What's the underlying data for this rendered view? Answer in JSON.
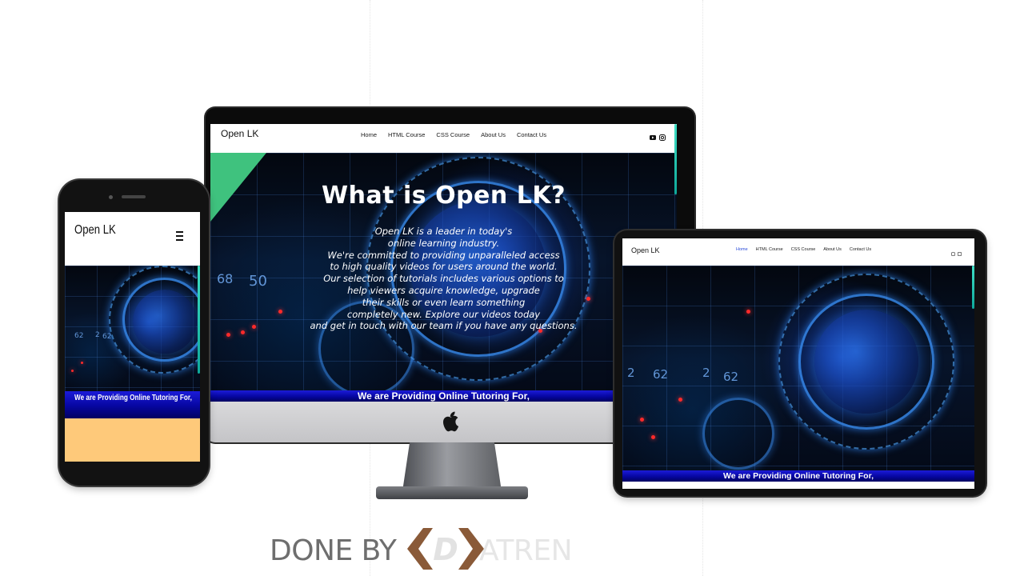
{
  "brand": "Open LK",
  "nav_items": [
    {
      "label": "Home",
      "active": true
    },
    {
      "label": "HTML Course",
      "active": false
    },
    {
      "label": "CSS Course",
      "active": false
    },
    {
      "label": "About Us",
      "active": false
    },
    {
      "label": "Contact Us",
      "active": false
    }
  ],
  "social_icons": [
    "youtube-icon",
    "instagram-icon"
  ],
  "hero": {
    "title": "What is Open LK?",
    "text_lines": [
      "Open LK is a leader in today's",
      "online learning industry.",
      "We're committed to providing unparalleled access",
      "to high quality videos for users around the world.",
      "Our selection of tutorials includes various options to",
      "help viewers acquire knowledge, upgrade",
      "their skills or even learn something",
      "completely new. Explore our videos today",
      "and get in touch with our team if you have any questions."
    ]
  },
  "banner": "We are Providing Online Tutoring For,",
  "credit": {
    "done_by": "DONE BY",
    "logo_letter": "D",
    "logo_rest": "ATREN"
  },
  "colors": {
    "accent_triangle": "#3fc27e",
    "scroll_accent": "#1fc7b3",
    "banner_blue": "#0a0ab8",
    "phone_section": "#fec97a",
    "logo_brown": "#8a5a38"
  }
}
